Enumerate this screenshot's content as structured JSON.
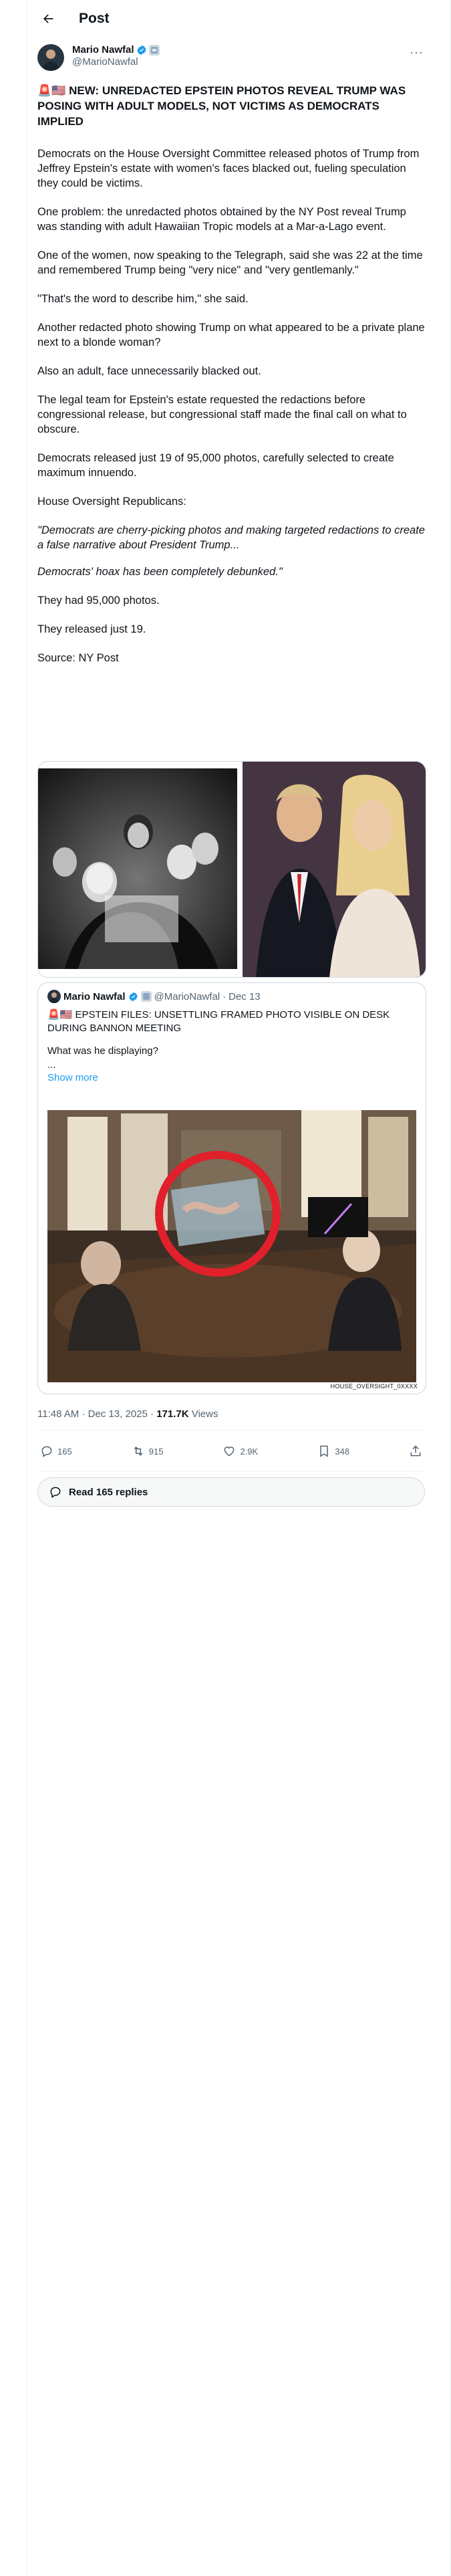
{
  "header": {
    "title": "Post"
  },
  "author": {
    "name": "Mario Nawfal",
    "handle": "@MarioNawfal"
  },
  "post": {
    "headline_emoji": "🚨🇺🇸",
    "headline": "NEW: UNREDACTED EPSTEIN PHOTOS REVEAL TRUMP WAS POSING WITH ADULT MODELS, NOT VICTIMS AS DEMOCRATS IMPLIED",
    "paragraphs": [
      "Democrats on the House Oversight Committee released photos of Trump from Jeffrey Epstein's estate with women's faces blacked out, fueling speculation they could be victims.",
      "One problem: the unredacted photos obtained by the NY Post reveal Trump was standing with adult Hawaiian Tropic models at a Mar-a-Lago event.",
      "One of the women, now speaking to the Telegraph, said she was 22 at the time and remembered Trump being \"very nice\" and \"very gentlemanly.\"",
      "\"That's the word to describe him,\" she said.",
      "Another redacted photo showing Trump on what appeared to be a private plane next to a blonde woman?",
      "Also an adult, face unnecessarily blacked out.",
      "The legal team for Epstein's estate requested the redactions before congressional release, but congressional staff made the final call on what to obscure.",
      "Democrats released just 19 of 95,000 photos, carefully selected to create maximum innuendo.",
      "House Oversight Republicans:"
    ],
    "quote_1": "\"Democrats are cherry-picking photos and making targeted redactions to create a false narrative about President Trump...",
    "quote_2": "Democrats' hoax has been completely debunked.\"",
    "closing": [
      "They had 95,000 photos.",
      "They released just 19.",
      "Source: NY Post"
    ]
  },
  "quoted_post": {
    "name": "Mario Nawfal",
    "handle": "@MarioNawfal",
    "separator": "·",
    "date": "Dec 13",
    "emoji": "🚨🇺🇸",
    "text": "EPSTEIN FILES: UNSETTLING FRAMED PHOTO VISIBLE ON DESK DURING BANNON MEETING",
    "line2": "What was he displaying?",
    "ellipsis": "...",
    "show_more": "Show more",
    "watermark": "HOUSE_OVERSIGHT_0XXXX"
  },
  "meta": {
    "time": "11:48 AM",
    "sep": "·",
    "date": "Dec 13, 2025",
    "sep2": "·",
    "views": "171.7K",
    "views_label": "Views"
  },
  "actions": {
    "replies": "165",
    "reposts": "915",
    "likes": "2.9K",
    "bookmarks": "348"
  },
  "read_replies": "Read 165 replies",
  "colors": {
    "accent": "#1d9bf0",
    "text": "#0f1419",
    "muted": "#536471",
    "border": "#cfd9de"
  }
}
